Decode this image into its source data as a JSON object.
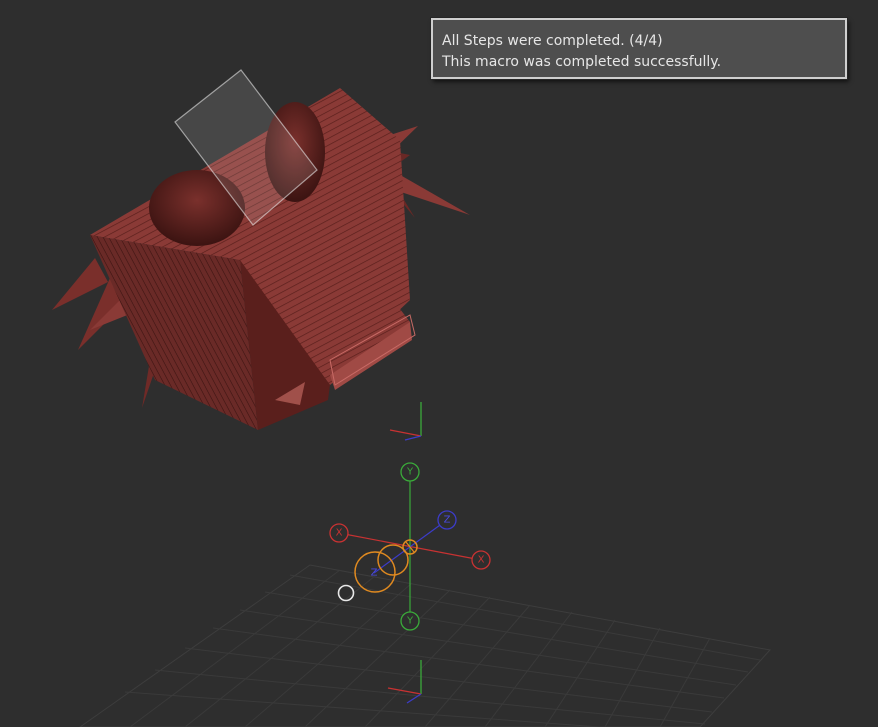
{
  "notification": {
    "line1": "All Steps were completed. (4/4)",
    "line2": "This macro was completed successfully."
  },
  "gizmo": {
    "labels": {
      "y_top": "Y",
      "y_bottom": "Y",
      "x_left": "X",
      "x_right": "X",
      "z_back": "Z",
      "z_front": "Z"
    }
  },
  "colors": {
    "background": "#2e2e2e",
    "model": "#8a3a36",
    "axis_x": "#c83232",
    "axis_y": "#3aaa3a",
    "axis_z": "#3c3cc8",
    "gizmo_ring": "#e08a20"
  }
}
